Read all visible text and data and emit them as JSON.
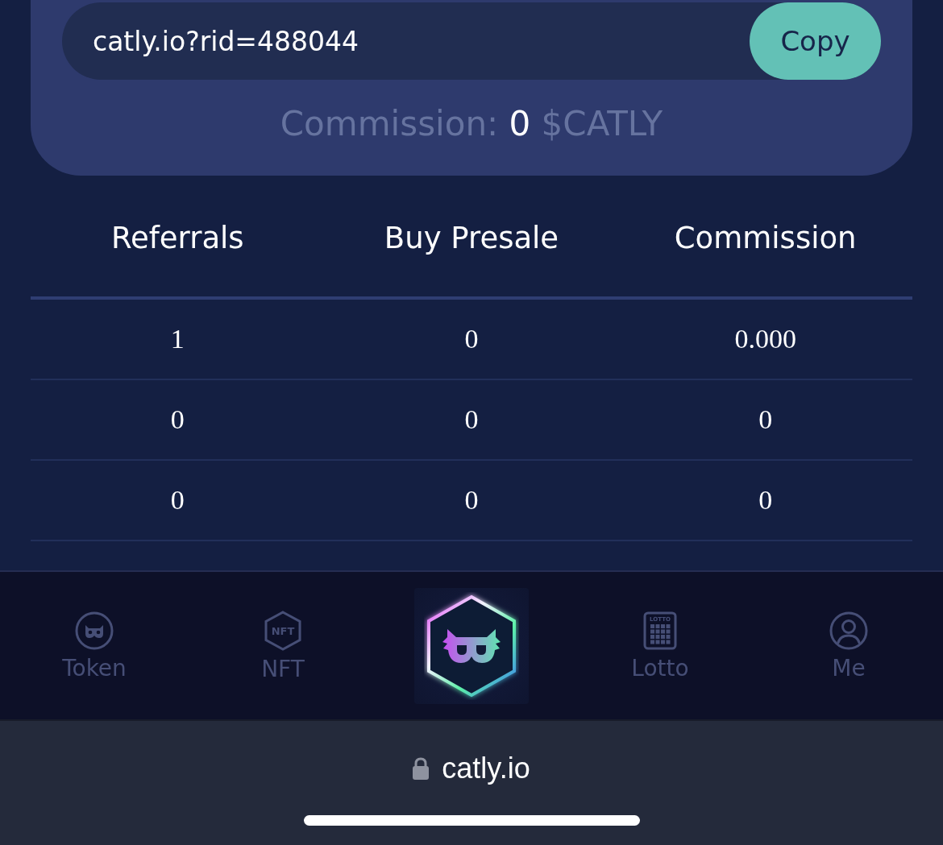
{
  "referral": {
    "link": "catly.io?rid=488044",
    "copy_button": "Copy",
    "commission": {
      "label": "Commission:",
      "value": "0",
      "unit": "$CATLY"
    }
  },
  "table": {
    "columns": [
      "Referrals",
      "Buy Presale",
      "Commission"
    ],
    "rows": [
      [
        "1",
        "0",
        "0.000"
      ],
      [
        "0",
        "0",
        "0"
      ],
      [
        "0",
        "0",
        "0"
      ]
    ]
  },
  "bottom_nav": {
    "items": [
      {
        "kind": "token",
        "label": "Token",
        "selected": false
      },
      {
        "kind": "nft",
        "label": "NFT",
        "icon_text": "NFT",
        "selected": false
      },
      {
        "kind": "logo",
        "selected": false
      },
      {
        "kind": "lotto",
        "label": "Lotto",
        "icon_text": "LOTTO",
        "selected": false
      },
      {
        "kind": "me",
        "label": "Me",
        "selected": false
      }
    ]
  },
  "browser_bar": {
    "url": "catly.io"
  }
}
